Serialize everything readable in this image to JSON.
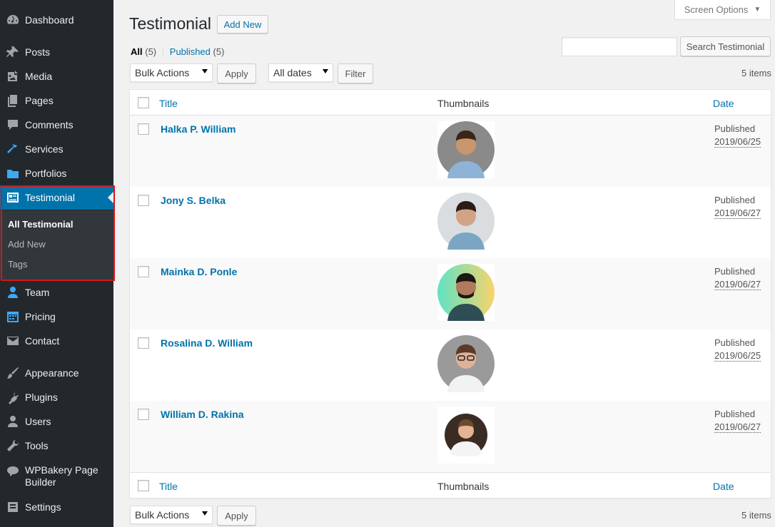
{
  "colors": {
    "sidebar_bg": "#23282d",
    "active_bg": "#0073aa",
    "link": "#0073aa",
    "highlight": "#d6171c"
  },
  "sidebar": {
    "items": [
      {
        "label": "Dashboard",
        "icon": "dashboard-icon"
      },
      {
        "label": "Posts",
        "icon": "pin-icon"
      },
      {
        "label": "Media",
        "icon": "media-icon"
      },
      {
        "label": "Pages",
        "icon": "pages-icon"
      },
      {
        "label": "Comments",
        "icon": "comment-icon"
      },
      {
        "label": "Services",
        "icon": "hammer-icon"
      },
      {
        "label": "Portfolios",
        "icon": "folder-icon"
      },
      {
        "label": "Testimonial",
        "icon": "id-card-icon"
      },
      {
        "label": "Team",
        "icon": "person-icon"
      },
      {
        "label": "Pricing",
        "icon": "calendar-icon"
      },
      {
        "label": "Contact",
        "icon": "mail-icon"
      },
      {
        "label": "Appearance",
        "icon": "brush-icon"
      },
      {
        "label": "Plugins",
        "icon": "plug-icon"
      },
      {
        "label": "Users",
        "icon": "users-icon"
      },
      {
        "label": "Tools",
        "icon": "wrench-icon"
      },
      {
        "label": "WPBakery Page Builder",
        "icon": "chat-bubble-icon"
      },
      {
        "label": "Settings",
        "icon": "settings-icon"
      }
    ],
    "submenu": [
      "All Testimonial",
      "Add New",
      "Tags"
    ]
  },
  "header": {
    "title": "Testimonial",
    "add_new": "Add New",
    "screen_options": "Screen Options"
  },
  "views": {
    "all_label": "All",
    "all_count": "(5)",
    "separator": "|",
    "published_label": "Published",
    "published_count": "(5)"
  },
  "search": {
    "value": "",
    "button": "Search Testimonial"
  },
  "toolbar": {
    "bulk_actions": "Bulk Actions",
    "apply": "Apply",
    "all_dates": "All dates",
    "filter": "Filter",
    "items_count": "5 items"
  },
  "table": {
    "columns": {
      "title": "Title",
      "thumbnails": "Thumbnails",
      "date": "Date"
    },
    "rows": [
      {
        "title": "Halka P. William",
        "status": "Published",
        "date": "2019/06/25"
      },
      {
        "title": "Jony S. Belka",
        "status": "Published",
        "date": "2019/06/27"
      },
      {
        "title": "Mainka D. Ponle",
        "status": "Published",
        "date": "2019/06/27"
      },
      {
        "title": "Rosalina D. William",
        "status": "Published",
        "date": "2019/06/25"
      },
      {
        "title": "William D. Rakina",
        "status": "Published",
        "date": "2019/06/27"
      }
    ]
  }
}
